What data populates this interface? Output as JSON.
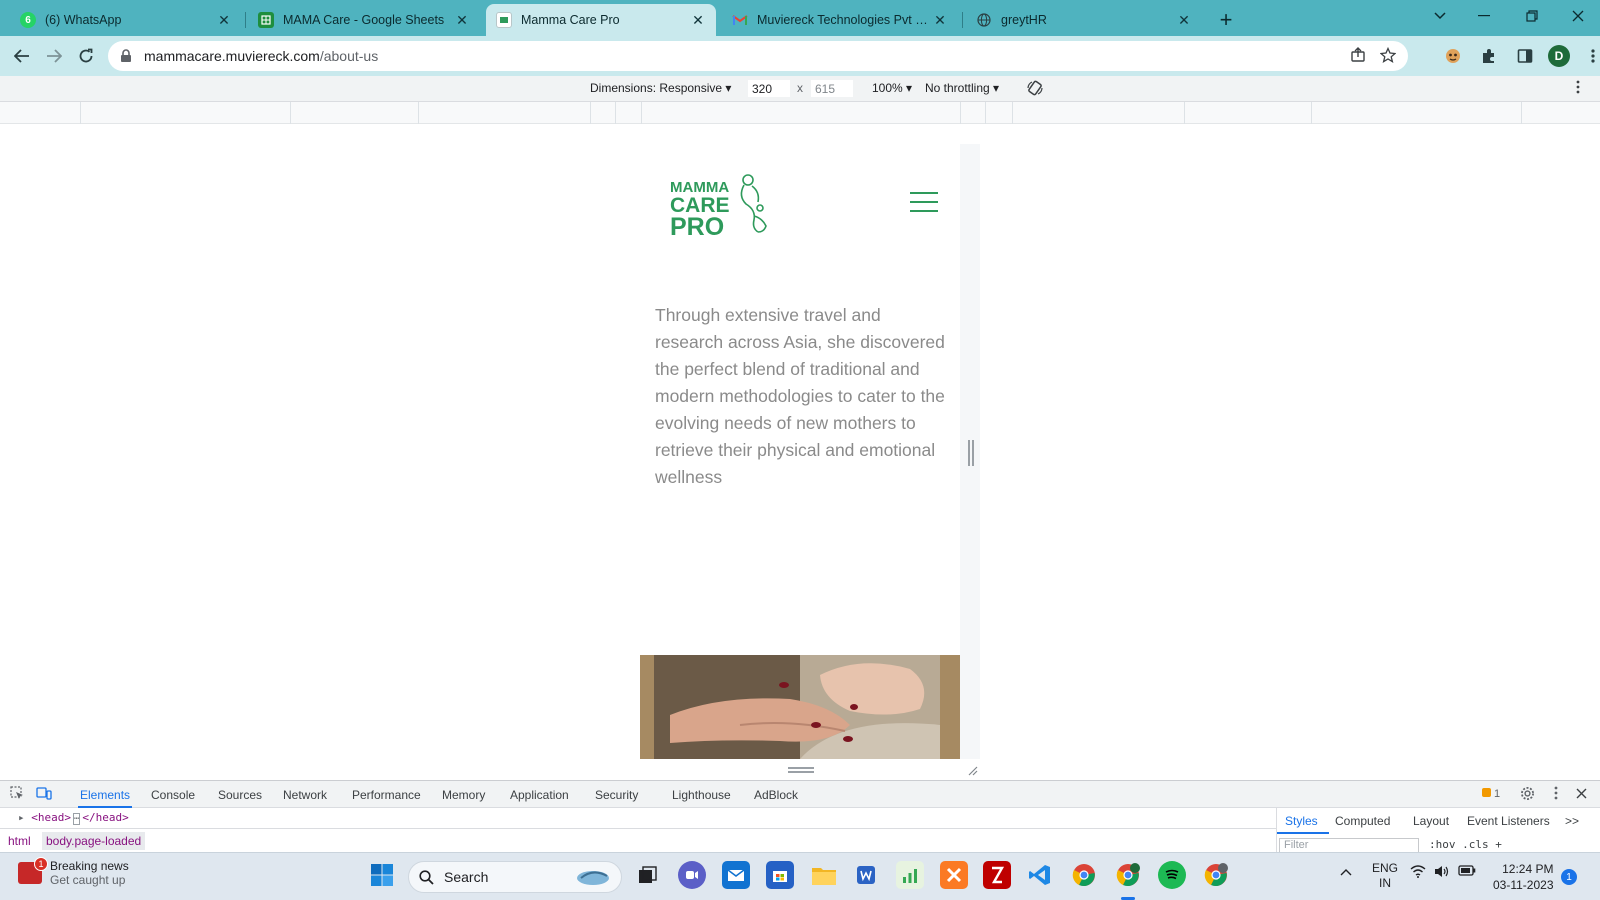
{
  "browser": {
    "tabs": [
      {
        "title": "(6) WhatsApp",
        "favicon_badge": "6"
      },
      {
        "title": "MAMA Care - Google Sheets"
      },
      {
        "title": "Mamma Care Pro",
        "active": true
      },
      {
        "title": "Muviereck Technologies Pvt Ltd"
      },
      {
        "title": "greytHR"
      }
    ],
    "close_glyph": "✕",
    "new_tab": "+",
    "url_host": "mammacare.muviereck.com",
    "url_path": "/about-us",
    "profile_initial": "D"
  },
  "device_toolbar": {
    "dimensions": "Dimensions: Responsive",
    "width": "320",
    "times": "x",
    "height": "615",
    "zoom": "100%",
    "throttling": "No throttling"
  },
  "page": {
    "logo_lines": [
      "MAMMA",
      "CARE",
      "PRO"
    ],
    "about_paragraph": "Through extensive travel and research across Asia, she discovered the perfect blend of traditional and modern methodologies to cater to the evolving needs of new mothers to retrieve their physical and emotional wellness",
    "brand_color": "#2e9a5b",
    "text_color": "#8a8a8a"
  },
  "devtools": {
    "tabs": [
      "Elements",
      "Console",
      "Sources",
      "Network",
      "Performance",
      "Memory",
      "Application",
      "Security",
      "Lighthouse",
      "AdBlock"
    ],
    "issues_count": "1",
    "dom_line_open": "<head>",
    "dom_line_ellipsis": "⋯",
    "dom_line_close": "</head>",
    "crumbs": [
      "html",
      "body.page-loaded"
    ],
    "side_tabs": [
      "Styles",
      "Computed",
      "Layout",
      "Event Listeners"
    ],
    "side_more": ">>",
    "filter_placeholder": "Filter",
    "side_tools": ":hov .cls +"
  },
  "taskbar": {
    "news_title": "Breaking news",
    "news_subtitle": "Get caught up",
    "news_badge": "1",
    "search_label": "Search",
    "lang_top": "ENG",
    "lang_bottom": "IN",
    "time": "12:24 PM",
    "date": "03-11-2023",
    "notifications": "1"
  }
}
